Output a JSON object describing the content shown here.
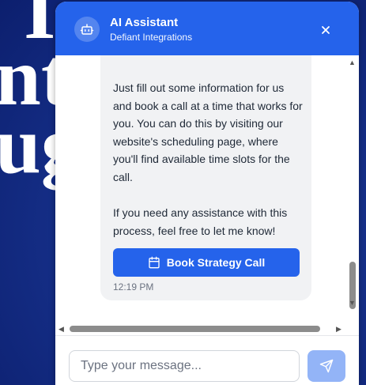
{
  "background": {
    "lines": [
      "I",
      "nt",
      "ug"
    ]
  },
  "header": {
    "title": "AI Assistant",
    "subtitle": "Defiant Integrations",
    "avatar_icon": "robot-icon",
    "close_icon": "close-icon",
    "color": "#2563eb"
  },
  "message": {
    "paragraphs": [
      "Just fill out some information for us and book a call at a time that works for you. You can do this by visiting our website's scheduling page, where you'll find available time slots for the call.",
      "If you need any assistance with this process, feel free to let me know!"
    ],
    "cta_label": "Book Strategy Call",
    "cta_icon": "calendar-icon",
    "time": "12:19 PM"
  },
  "composer": {
    "placeholder": "Type your message...",
    "value": "",
    "send_icon": "send-icon"
  }
}
